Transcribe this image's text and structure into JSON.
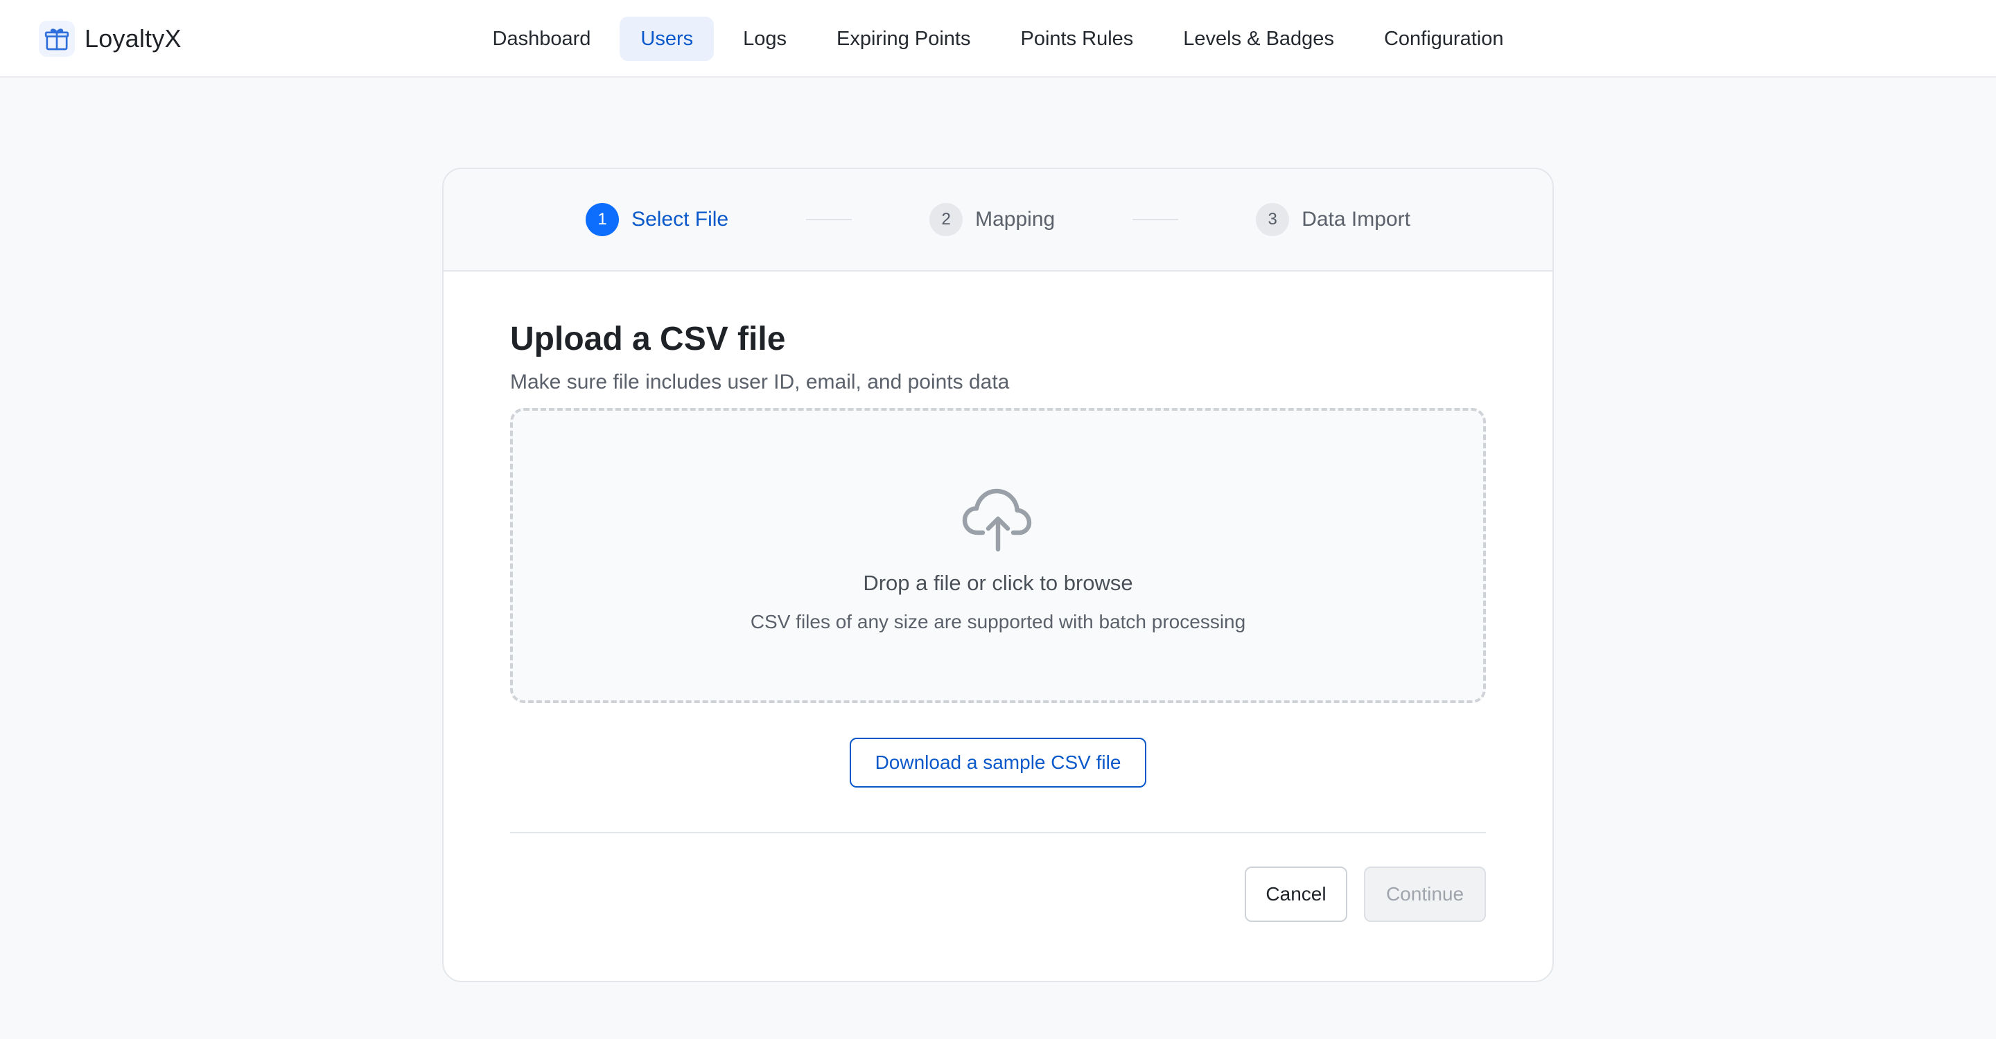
{
  "app": {
    "name": "LoyaltyX",
    "logo_icon": "gift-icon",
    "accent_color": "#0d6efd"
  },
  "nav": {
    "items": [
      {
        "label": "Dashboard",
        "active": false
      },
      {
        "label": "Users",
        "active": true
      },
      {
        "label": "Logs",
        "active": false
      },
      {
        "label": "Expiring Points",
        "active": false
      },
      {
        "label": "Points Rules",
        "active": false
      },
      {
        "label": "Levels & Badges",
        "active": false
      },
      {
        "label": "Configuration",
        "active": false
      }
    ]
  },
  "stepper": {
    "steps": [
      {
        "number": "1",
        "label": "Select File",
        "active": true
      },
      {
        "number": "2",
        "label": "Mapping",
        "active": false
      },
      {
        "number": "3",
        "label": "Data Import",
        "active": false
      }
    ]
  },
  "upload": {
    "title": "Upload a CSV file",
    "subtitle": "Make sure file includes user ID, email, and points data",
    "dropzone_icon": "cloud-upload-icon",
    "dropzone_title": "Drop a file or click to browse",
    "dropzone_hint": "CSV files of any size are supported with batch processing",
    "sample_button": "Download a sample CSV file"
  },
  "footer": {
    "cancel_label": "Cancel",
    "continue_label": "Continue",
    "continue_disabled": true
  }
}
